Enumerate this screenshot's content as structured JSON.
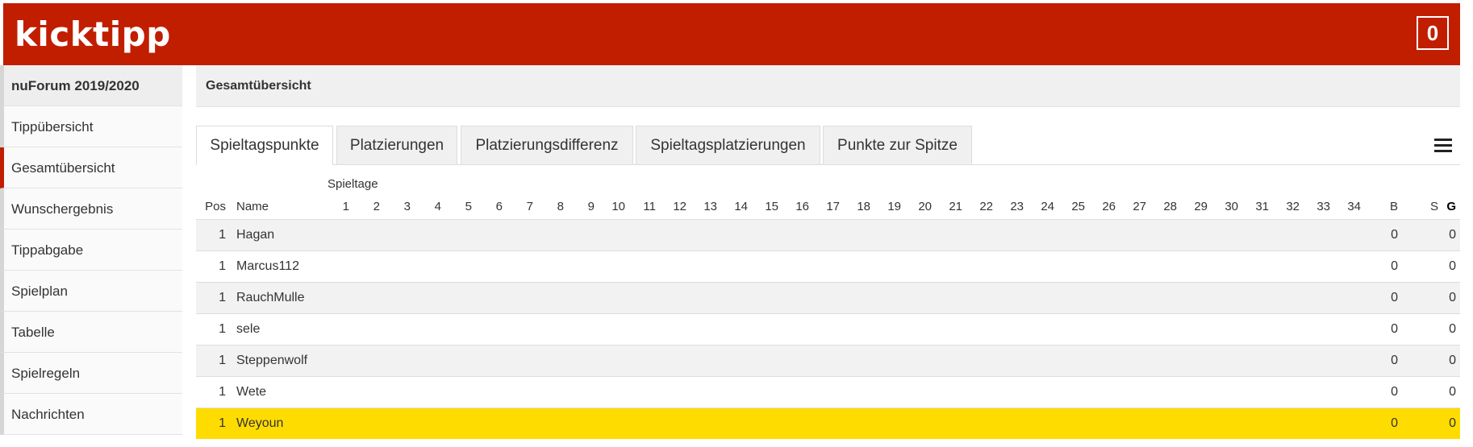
{
  "app": {
    "logo": "kicktipp",
    "counter": "0"
  },
  "sidebar": {
    "items": [
      {
        "label": "nuForum 2019/2020"
      },
      {
        "label": "Tippübersicht"
      },
      {
        "label": "Gesamtübersicht"
      },
      {
        "label": "Wunschergebnis"
      },
      {
        "label": "Tippabgabe"
      },
      {
        "label": "Spielplan"
      },
      {
        "label": "Tabelle"
      },
      {
        "label": "Spielregeln"
      },
      {
        "label": "Nachrichten"
      }
    ]
  },
  "page": {
    "title": "Gesamtübersicht"
  },
  "tabs": [
    {
      "label": "Spieltagspunkte"
    },
    {
      "label": "Platzierungen"
    },
    {
      "label": "Platzierungsdifferenz"
    },
    {
      "label": "Spieltagsplatzierungen"
    },
    {
      "label": "Punkte zur Spitze"
    }
  ],
  "icons": {
    "menu": "hamburger-menu-icon"
  },
  "colors": {
    "brand": "#c11e00",
    "highlight": "#ffdc00",
    "row_alt": "#f2f2f2"
  },
  "table": {
    "group_header": "Spieltage",
    "headers": {
      "pos": "Pos",
      "name": "Name",
      "b": "B",
      "s": "S",
      "g": "G"
    },
    "spieltage": [
      "1",
      "2",
      "3",
      "4",
      "5",
      "6",
      "7",
      "8",
      "9",
      "10",
      "11",
      "12",
      "13",
      "14",
      "15",
      "16",
      "17",
      "18",
      "19",
      "20",
      "21",
      "22",
      "23",
      "24",
      "25",
      "26",
      "27",
      "28",
      "29",
      "30",
      "31",
      "32",
      "33",
      "34"
    ],
    "rows": [
      {
        "pos": "1",
        "name": "Hagan",
        "b": "0",
        "g": "0"
      },
      {
        "pos": "1",
        "name": "Marcus112",
        "b": "0",
        "g": "0"
      },
      {
        "pos": "1",
        "name": "RauchMulle",
        "b": "0",
        "g": "0"
      },
      {
        "pos": "1",
        "name": "sele",
        "b": "0",
        "g": "0"
      },
      {
        "pos": "1",
        "name": "Steppenwolf",
        "b": "0",
        "g": "0"
      },
      {
        "pos": "1",
        "name": "Wete",
        "b": "0",
        "g": "0"
      },
      {
        "pos": "1",
        "name": "Weyoun",
        "b": "0",
        "g": "0",
        "highlighted": true
      }
    ]
  }
}
